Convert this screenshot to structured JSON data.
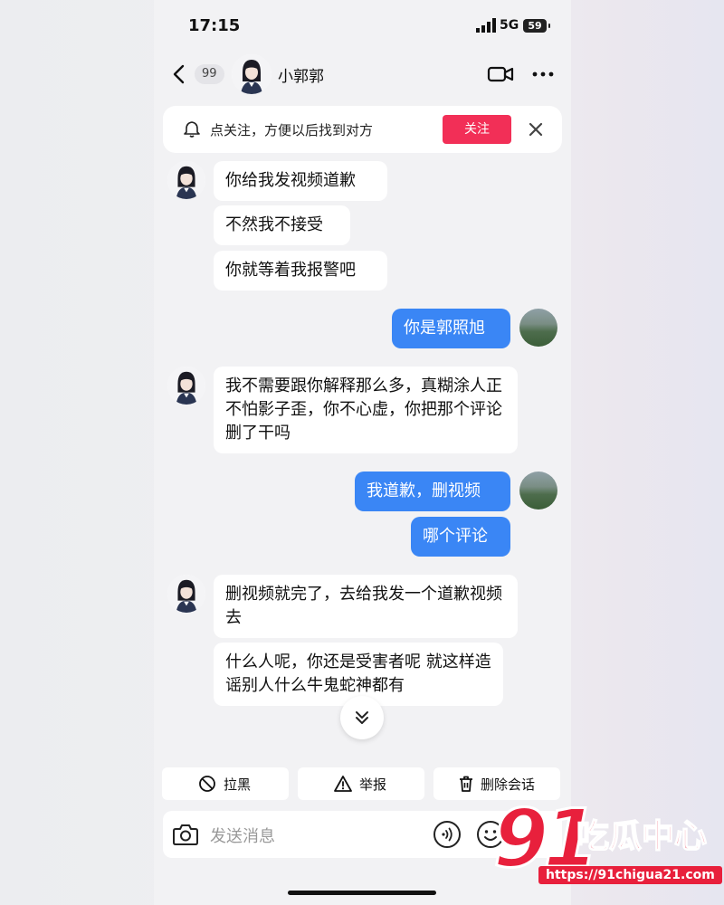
{
  "status": {
    "time": "17:15",
    "network": "5G",
    "battery": "59"
  },
  "header": {
    "unread_count": "99",
    "contact_name": "小郭郭"
  },
  "follow_bar": {
    "text": "点关注，方便以后找到对方",
    "button": "关注"
  },
  "messages": [
    {
      "side": "in",
      "text": "你给我发视频道歉"
    },
    {
      "side": "in",
      "text": "不然我不接受"
    },
    {
      "side": "in",
      "text": "你就等着我报警吧"
    },
    {
      "side": "out",
      "text": "你是郭照旭"
    },
    {
      "side": "in",
      "text": "我不需要跟你解释那么多，真糊涂人正不怕影子歪，你不心虚，你把那个评论删了干吗"
    },
    {
      "side": "out",
      "text": "我道歉，删视频"
    },
    {
      "side": "out",
      "text": "哪个评论"
    },
    {
      "side": "in",
      "text": "删视频就完了，去给我发一个道歉视频去"
    },
    {
      "side": "in",
      "text": "什么人呢，你还是受害者呢 就这样造谣别人什么牛鬼蛇神都有"
    }
  ],
  "actions": {
    "block": "拉黑",
    "report": "举报",
    "delete_chat": "删除会话"
  },
  "input": {
    "placeholder": "发送消息"
  },
  "watermark": {
    "brand_number": "91",
    "brand_text": "吃瓜中心",
    "url": "https://91chigua21.com"
  },
  "colors": {
    "accent_blue": "#3a86f5",
    "follow_red": "#f22f57",
    "watermark_red": "#e8203c"
  }
}
